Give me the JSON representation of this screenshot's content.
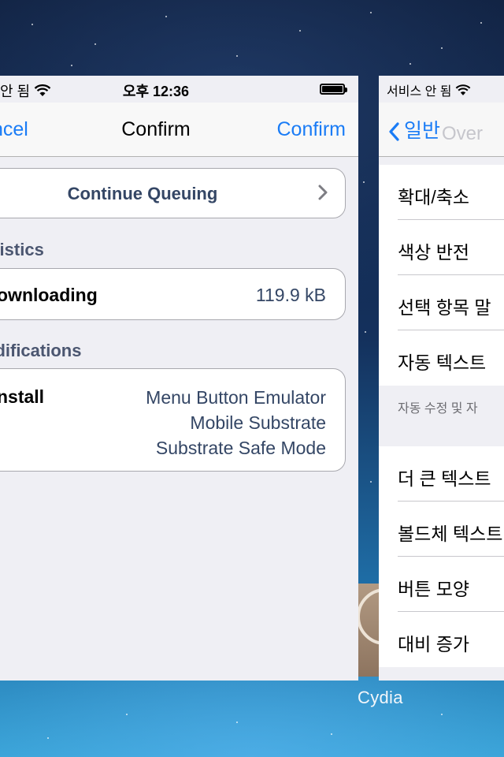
{
  "left_card": {
    "status": {
      "carrier": "안 됨",
      "time": "오후 12:36"
    },
    "nav": {
      "cancel": "ncel",
      "title": "Confirm",
      "confirm": "Confirm"
    },
    "queue_button": "Continue Queuing",
    "statistics": {
      "header": "atistics",
      "label": "ownloading",
      "value": "119.9 kB"
    },
    "modifications": {
      "header": "odifications",
      "install_label": "nstall",
      "packages": [
        "Menu Button Emulator",
        "Mobile Substrate",
        "Substrate Safe Mode"
      ]
    }
  },
  "right_card": {
    "status": {
      "carrier": "서비스 안 됨"
    },
    "nav": {
      "back": "일반",
      "faint_title": "Over"
    },
    "rows": [
      "확대/축소",
      "색상 반전",
      "선택 항목 말",
      "자동 텍스트 "
    ],
    "note": "자동 수정 및 자",
    "rows2": [
      "더 큰 텍스트",
      "볼드체 텍스트",
      "버튼 모양",
      "대비 증가"
    ]
  },
  "apps": {
    "cydia_label": "Cydia"
  },
  "icons": [
    "wifi-icon",
    "battery-icon",
    "chevron-right-icon",
    "back-chevron-icon"
  ],
  "colors": {
    "accent": "#1a7cf6",
    "value_text": "#344665",
    "grouped_bg": "#efeff4"
  }
}
